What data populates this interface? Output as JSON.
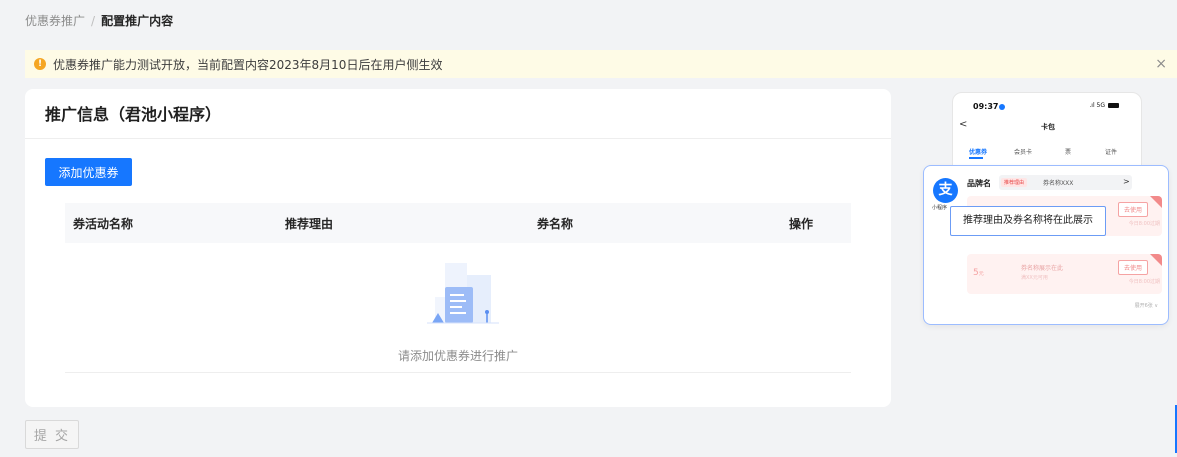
{
  "breadcrumb": {
    "parent": "优惠券推广",
    "separator": "/",
    "current": "配置推广内容"
  },
  "notice": {
    "text": "优惠券推广能力测试开放，当前配置内容2023年8月10日后在用户侧生效",
    "icon": "warning-icon",
    "close": "×",
    "color": "#fefbe6"
  },
  "card": {
    "title": "推广信息（君池小程序）",
    "add_button": "添加优惠券",
    "table": {
      "columns": [
        "券活动名称",
        "推荐理由",
        "券名称",
        "操作"
      ],
      "empty_text": "请添加优惠券进行推广"
    }
  },
  "submit_label": "提 交",
  "preview": {
    "time": "09:37",
    "signal": ".ıl 5G",
    "back": "<",
    "title": "卡包",
    "tabs": [
      "优惠券",
      "会员卡",
      "票",
      "证件"
    ],
    "logo_char": "支",
    "mini_label": "小程序",
    "brand": "品牌名",
    "reason_tag": "推荐理由",
    "coupon_name_top": "券名称XXX",
    "chevron": ">",
    "coupon_display_name": "券名称展示在此",
    "coupon_condition": "满XX元可用",
    "use_button": "去使用",
    "expire_text": "今日8:00过期",
    "amount": "5",
    "amount_unit": "元",
    "expand": "展开6张 ∨",
    "tooltip": "推荐理由及券名称将在此展示"
  },
  "colors": {
    "accent": "#1677ff",
    "background": "#f2f3f5",
    "coupon": "#fff2f1"
  }
}
